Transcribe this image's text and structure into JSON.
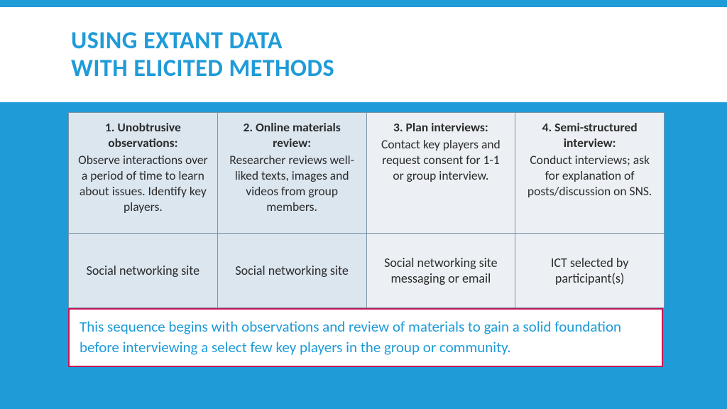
{
  "title": {
    "line1": "USING EXTANT DATA",
    "line2": "WITH ELICITED METHODS"
  },
  "table": {
    "cols": [
      {
        "heading": "1. Unobtrusive observations:",
        "body": "Observe interactions over a period of time to learn about issues. Identify key players.",
        "venue": "Social networking site"
      },
      {
        "heading": "2. Online materials review:",
        "body": "Researcher reviews well-liked texts, images and videos from group members.",
        "venue": "Social networking site"
      },
      {
        "heading": "3. Plan interviews:",
        "body": "Contact key players and request consent for 1-1 or group interview.",
        "venue": "Social networking site messaging or email"
      },
      {
        "heading": "4. Semi-structured interview:",
        "body": "Conduct interviews; ask for explanation of posts/discussion on SNS.",
        "venue": "ICT selected by participant(s)"
      }
    ]
  },
  "caption": "This sequence begins with observations and review of materials to gain a solid foundation before interviewing a select few key players in the group or community."
}
